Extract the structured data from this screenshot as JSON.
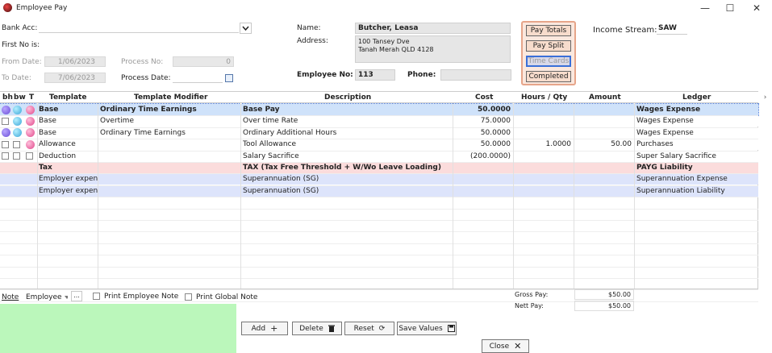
{
  "window": {
    "title": "Employee Pay",
    "minimize": "—",
    "maximize": "☐",
    "close": "✕"
  },
  "left": {
    "bank_acc_label": "Bank Acc:",
    "first_no_label": "First No is:",
    "from_date_label": "From Date:",
    "from_date_value": "1/06/2023",
    "to_date_label": "To Date:",
    "to_date_value": "7/06/2023",
    "process_no_label": "Process No:",
    "process_no_value": "0",
    "process_date_label": "Process Date:"
  },
  "employee": {
    "name_label": "Name:",
    "name_value": "Butcher, Leasa",
    "address_label": "Address:",
    "address_line1": "100 Tansey Dve",
    "address_line2": "Tanah Merah QLD 4128",
    "employee_no_label": "Employee No:",
    "employee_no_value": "113",
    "phone_label": "Phone:",
    "phone_value": ""
  },
  "pay_panel": {
    "pay_totals": "Pay Totals",
    "pay_split": "Pay Split",
    "time_cards": "Time Cards",
    "completed": "Completed"
  },
  "income": {
    "label": "Income Stream:",
    "value": "SAW"
  },
  "table": {
    "headers": {
      "bh": "bh",
      "bw": "bw",
      "t": "T",
      "template": "Template",
      "modifier": "Template Modifier",
      "description": "Description",
      "cost": "Cost",
      "hours": "Hours / Qty",
      "amount": "Amount",
      "ledger": "Ledger"
    },
    "rows": [
      {
        "template": "Base",
        "modifier": "Ordinary Time Earnings",
        "description": "Base Pay",
        "cost": "50.0000",
        "hours": "",
        "amount": "",
        "ledger": "Wages Expense",
        "style": "selected",
        "icons": [
          "p",
          "b",
          "k"
        ]
      },
      {
        "template": "Base",
        "modifier": "Overtime",
        "description": "Over time Rate",
        "cost": "75.0000",
        "hours": "",
        "amount": "",
        "ledger": "Wages Expense",
        "style": "normal",
        "icons": [
          "cb",
          "b",
          "k"
        ]
      },
      {
        "template": "Base",
        "modifier": "Ordinary Time Earnings",
        "description": "Ordinary Additional Hours",
        "cost": "50.0000",
        "hours": "",
        "amount": "",
        "ledger": "Wages Expense",
        "style": "normal",
        "icons": [
          "p",
          "b",
          "k"
        ]
      },
      {
        "template": "Allowance",
        "modifier": "",
        "description": "Tool Allowance",
        "cost": "50.0000",
        "hours": "1.0000",
        "amount": "50.00",
        "ledger": "Purchases",
        "style": "normal",
        "icons": [
          "cb",
          "cb",
          "k"
        ]
      },
      {
        "template": "Deduction",
        "modifier": "",
        "description": "Salary Sacrifice",
        "cost": "(200.0000)",
        "hours": "",
        "amount": "",
        "ledger": "Super Salary Sacrifice",
        "style": "normal",
        "icons": [
          "cb",
          "cb",
          "cb"
        ]
      },
      {
        "template": "Tax",
        "modifier": "",
        "description": "TAX (Tax Free Threshold  + W/Wo Leave Loading)",
        "cost": "",
        "hours": "",
        "amount": "",
        "ledger": "PAYG Liability",
        "style": "tax",
        "icons": []
      },
      {
        "template": "Employer expen",
        "modifier": "",
        "description": "Superannuation (SG)",
        "cost": "",
        "hours": "",
        "amount": "",
        "ledger": "Superannuation Expense",
        "style": "employer",
        "icons": []
      },
      {
        "template": "Employer expen",
        "modifier": "",
        "description": "Superannuation (SG)",
        "cost": "",
        "hours": "",
        "amount": "",
        "ledger": "Superannuation Liability",
        "style": "employer",
        "icons": []
      }
    ]
  },
  "bottom": {
    "note_label": "Note",
    "note_select": "Employee",
    "ellipsis": "...",
    "print_employee_note": "Print Employee Note",
    "print_global_note": "Print Global Note",
    "gross_pay_label": "Gross Pay:",
    "gross_pay_value": "$50.00",
    "nett_pay_label": "Nett Pay:",
    "nett_pay_value": "$50.00",
    "add": "Add",
    "delete": "Delete",
    "reset": "Reset",
    "save_values": "Save Values",
    "close": "Close"
  },
  "colors": {
    "selected": "#cfe2fa",
    "tax": "#fbdcdc",
    "employer": "#dde4fb",
    "note_panel": "#bbf7bb"
  }
}
